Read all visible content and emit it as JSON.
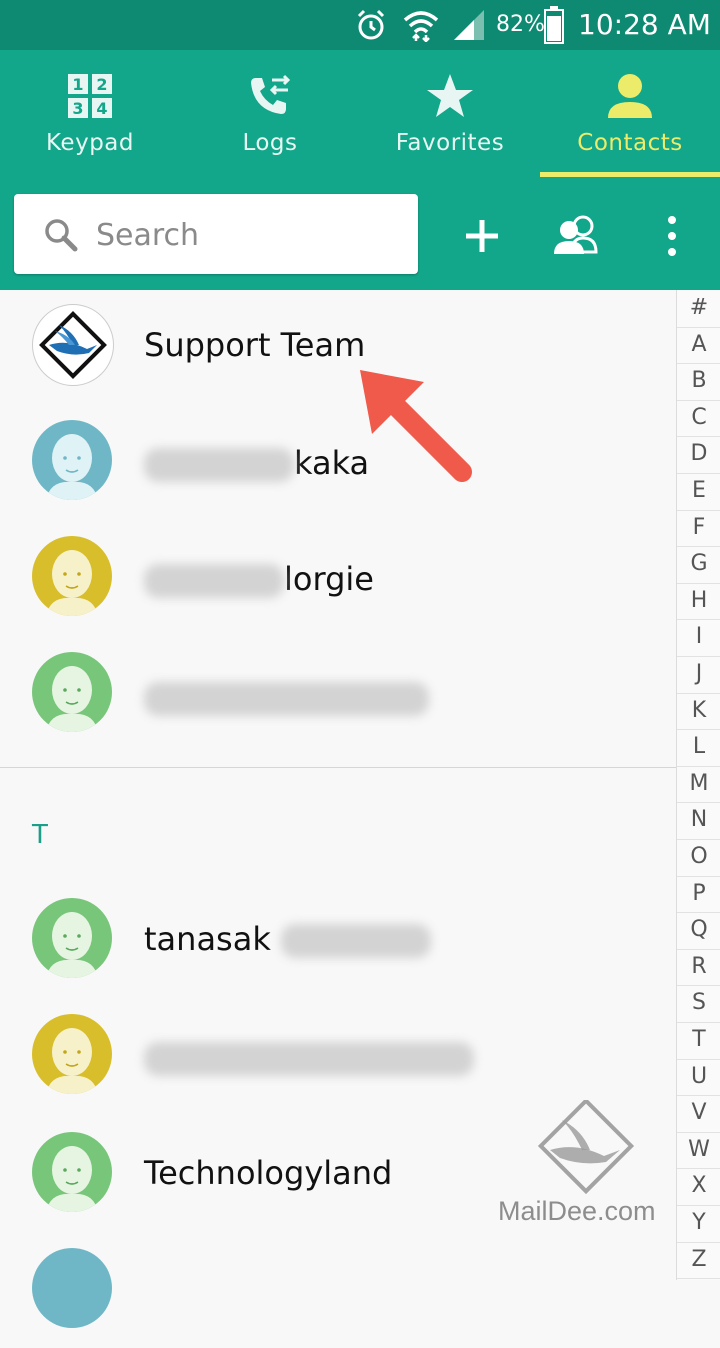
{
  "status_bar": {
    "battery_percent": "82%",
    "time": "10:28 AM",
    "icons": [
      "alarm-icon",
      "wifi-icon",
      "signal-icon",
      "battery-icon"
    ]
  },
  "tabs": [
    {
      "label": "Keypad",
      "icon": "keypad-icon",
      "active": false
    },
    {
      "label": "Logs",
      "icon": "call-log-icon",
      "active": false
    },
    {
      "label": "Favorites",
      "icon": "star-icon",
      "active": false
    },
    {
      "label": "Contacts",
      "icon": "contact-person-icon",
      "active": true
    }
  ],
  "search": {
    "placeholder": "Search",
    "value": ""
  },
  "actions": [
    "add-icon",
    "groups-icon",
    "more-options-icon"
  ],
  "contacts": [
    {
      "name": "Support Team",
      "suffix": "",
      "avatar": "logo"
    },
    {
      "name": "",
      "suffix": "kaka",
      "avatar": "blue"
    },
    {
      "name": "",
      "suffix": "lorgie",
      "avatar": "yellow"
    },
    {
      "name": "",
      "suffix": "",
      "avatar": "green"
    }
  ],
  "section_letter": "T",
  "contacts_t": [
    {
      "name": "tanasak",
      "avatar": "green"
    },
    {
      "name": "",
      "avatar": "yellow"
    },
    {
      "name": "Technologyland",
      "avatar": "green"
    }
  ],
  "index_letters": [
    "#",
    "A",
    "B",
    "C",
    "D",
    "E",
    "F",
    "G",
    "H",
    "I",
    "J",
    "K",
    "L",
    "M",
    "N",
    "O",
    "P",
    "Q",
    "R",
    "S",
    "T",
    "U",
    "V",
    "W",
    "X",
    "Y",
    "Z"
  ],
  "watermark": "MailDee.com",
  "colors": {
    "status_bar": "#0f8a72",
    "app_bar": "#12a68a",
    "active_tab": "#ecec6a",
    "annotation_arrow": "#ef5a4a"
  }
}
